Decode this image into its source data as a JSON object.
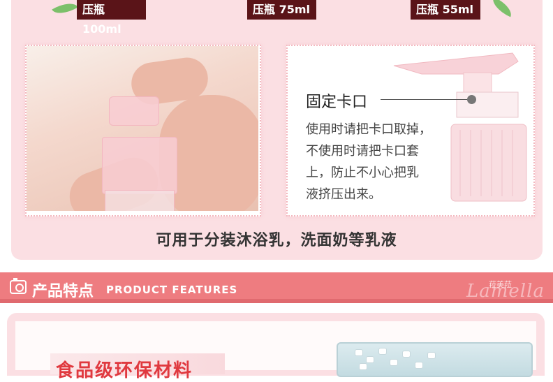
{
  "bottles": [
    {
      "label": "压瓶100ml"
    },
    {
      "label": "压瓶 75ml"
    },
    {
      "label": "压瓶 55ml"
    }
  ],
  "detail": {
    "title": "固定卡口",
    "lines": [
      "使用时请把卡口取掉，",
      "不使用时请把卡口套",
      "上，防止不小心把乳",
      "液挤压出来。"
    ]
  },
  "caption": "可用于分装沐浴乳，洗面奶等乳液",
  "section": {
    "title": "产品特点",
    "subtitle": "PRODUCT FEATURES",
    "brand_cn": "菈美菈",
    "brand_en": "Lamella"
  },
  "feature": {
    "title": "食品级环保材料"
  },
  "colors": {
    "panel_pink": "#fbdfe3",
    "header_coral": "#ee7c80",
    "label_bg": "#5a1418",
    "feature_red": "#e0393f"
  }
}
